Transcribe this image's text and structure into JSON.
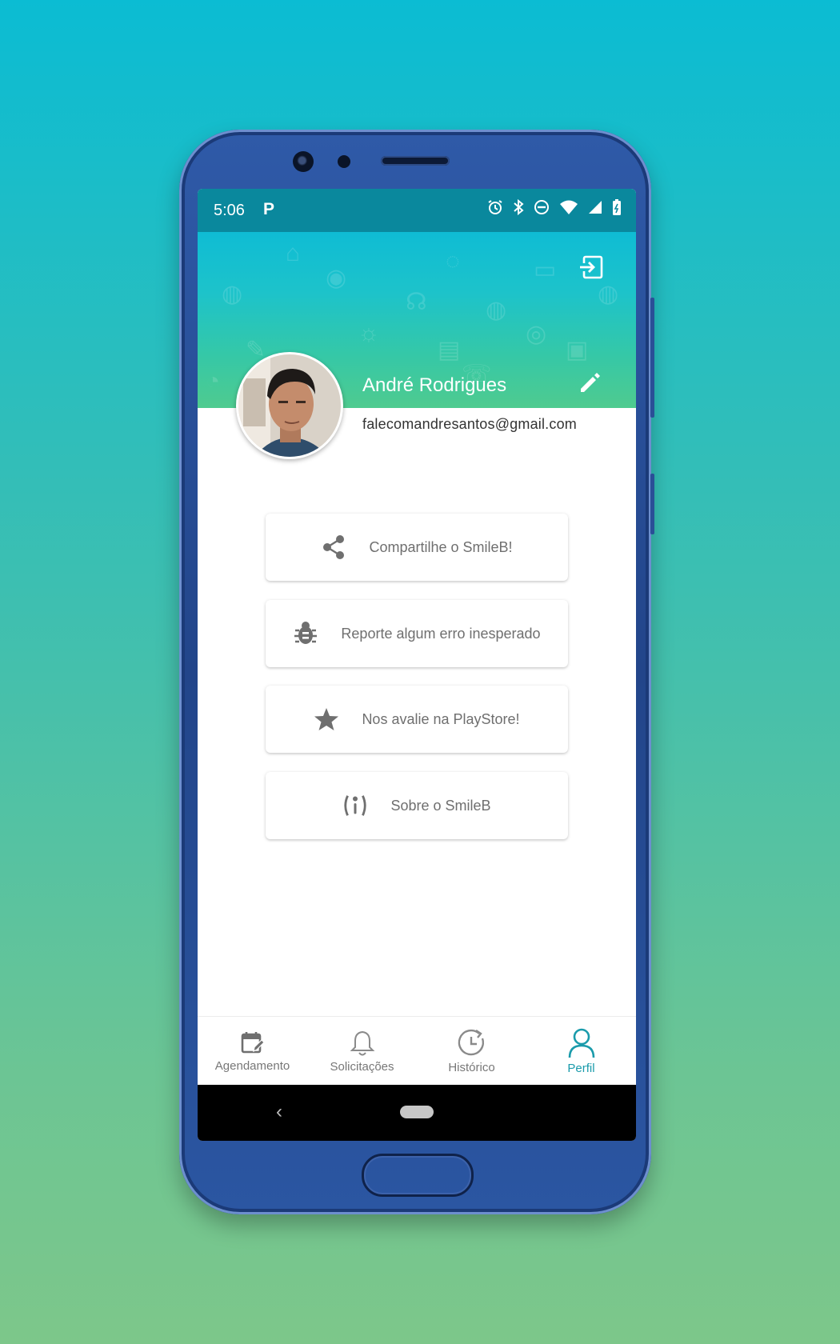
{
  "status_bar": {
    "time": "5:06",
    "notification_glyph": "P",
    "icons": [
      "alarm-icon",
      "bluetooth-icon",
      "do-not-disturb-icon",
      "wifi-icon",
      "signal-icon",
      "battery-icon"
    ]
  },
  "header": {
    "logout_icon": "logout-icon",
    "edit_icon": "edit-icon"
  },
  "profile": {
    "name": "André Rodrigues",
    "email": "falecomandresantos@gmail.com"
  },
  "menu": [
    {
      "label": "Compartilhe o SmileB!",
      "icon": "share-icon"
    },
    {
      "label": "Reporte algum erro inesperado",
      "icon": "bug-icon"
    },
    {
      "label": "Nos avalie na PlayStore!",
      "icon": "star-icon"
    },
    {
      "label": "Sobre o SmileB",
      "icon": "info-icon"
    }
  ],
  "bottom_nav": [
    {
      "label": "Agendamento",
      "icon": "calendar-edit-icon",
      "active": false
    },
    {
      "label": "Solicitações",
      "icon": "bell-icon",
      "active": false
    },
    {
      "label": "Histórico",
      "icon": "history-icon",
      "active": false
    },
    {
      "label": "Perfil",
      "icon": "person-icon",
      "active": true
    }
  ],
  "colors": {
    "accent": "#1a9bab",
    "status_bar": "#0a889d",
    "header_top": "#0fbcd4",
    "header_bottom": "#4fcb8f",
    "icon_gray": "#6f6f6f"
  }
}
